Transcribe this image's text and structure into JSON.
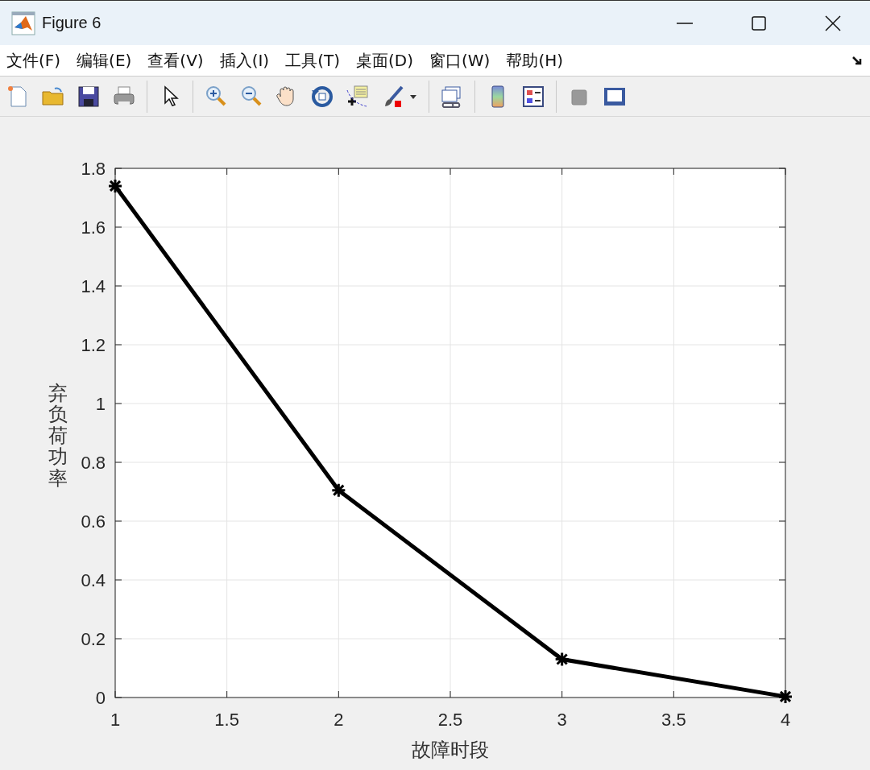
{
  "window": {
    "title": "Figure 6"
  },
  "menu": [
    {
      "label": "文件(F)"
    },
    {
      "label": "编辑(E)"
    },
    {
      "label": "查看(V)"
    },
    {
      "label": "插入(I)"
    },
    {
      "label": "工具(T)"
    },
    {
      "label": "桌面(D)"
    },
    {
      "label": "窗口(W)"
    },
    {
      "label": "帮助(H)"
    }
  ],
  "chart_data": {
    "type": "line",
    "xlabel": "故障时段",
    "ylabel": "弃负荷功率",
    "x": [
      1,
      2,
      3,
      4
    ],
    "series": [
      {
        "color": "#000000",
        "marker": "cross",
        "values": [
          1.74,
          0.705,
          0.13,
          0.003
        ]
      }
    ],
    "grid": true,
    "xlim": [
      1,
      4
    ],
    "ylim": [
      0,
      1.8
    ],
    "xticks": [
      1,
      1.5,
      2,
      2.5,
      3,
      3.5,
      4
    ],
    "yticks": [
      0,
      0.2,
      0.4,
      0.6,
      0.8,
      1,
      1.2,
      1.4,
      1.6,
      1.8
    ]
  }
}
